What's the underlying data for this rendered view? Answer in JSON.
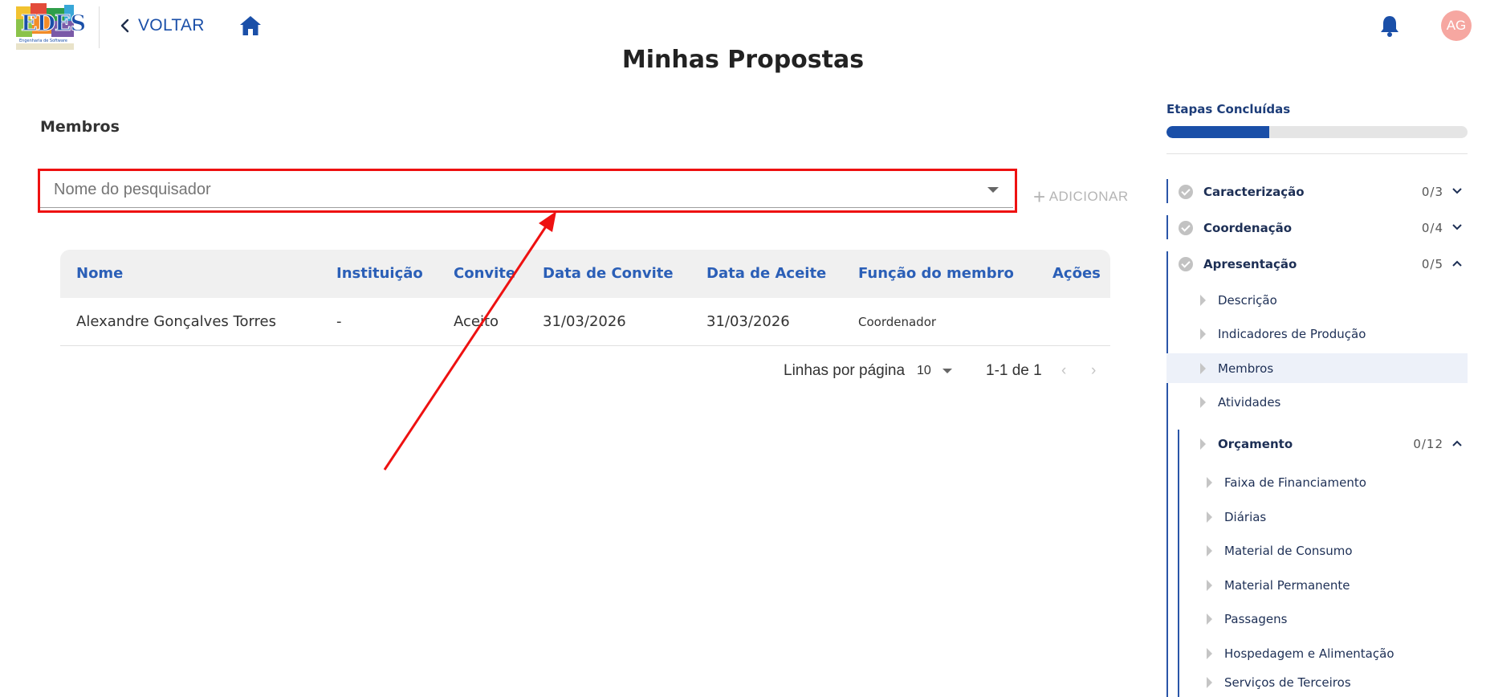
{
  "header": {
    "logo_text": "EDES",
    "logo_subtitle": "Engenharia de Software",
    "back_label": "VOLTAR",
    "avatar_initials": "AG",
    "icons": [
      "chevron-left-icon",
      "home-icon",
      "bell-icon"
    ]
  },
  "page_title": "Minhas Propostas",
  "main": {
    "section_title": "Membros",
    "researcher_select": {
      "placeholder": "Nome do pesquisador"
    },
    "add_label": "ADICIONAR",
    "table": {
      "columns": [
        "Nome",
        "Instituição",
        "Convite",
        "Data de Convite",
        "Data de Aceite",
        "Função do membro",
        "Ações"
      ],
      "rows": [
        {
          "nome": "Alexandre Gonçalves Torres",
          "instituicao": "-",
          "convite": "Aceito",
          "data_convite": "31/03/2026",
          "data_aceite": "31/03/2026",
          "funcao": "Coordenador",
          "acoes": ""
        }
      ]
    },
    "pagination": {
      "rows_per_page_label": "Linhas por página",
      "rows_per_page": "10",
      "range": "1-1 de 1",
      "prev": "‹",
      "next": "›"
    }
  },
  "sidebar": {
    "steps_label": "Etapas Concluídas",
    "progress_fraction": 0.34,
    "sections": [
      {
        "label": "Caracterização",
        "count": "0/3",
        "expanded": false
      },
      {
        "label": "Coordenação",
        "count": "0/4",
        "expanded": false
      },
      {
        "label": "Apresentação",
        "count": "0/5",
        "expanded": true
      }
    ],
    "apresentacao_items": [
      "Descrição",
      "Indicadores de Produção",
      "Membros",
      "Atividades"
    ],
    "active_item": "Membros",
    "orcamento": {
      "label": "Orçamento",
      "count": "0/12",
      "expanded": true
    },
    "orcamento_items": [
      "Faixa de Financiamento",
      "Diárias",
      "Material de Consumo",
      "Material Permanente",
      "Passagens",
      "Hospedagem e Alimentação",
      "Serviços de Terceiros"
    ]
  },
  "colors": {
    "primary": "#1a4fa8",
    "header_text": "#2b5fb7",
    "highlight": "#ee1111",
    "avatar_bg": "#f6a7a1"
  }
}
